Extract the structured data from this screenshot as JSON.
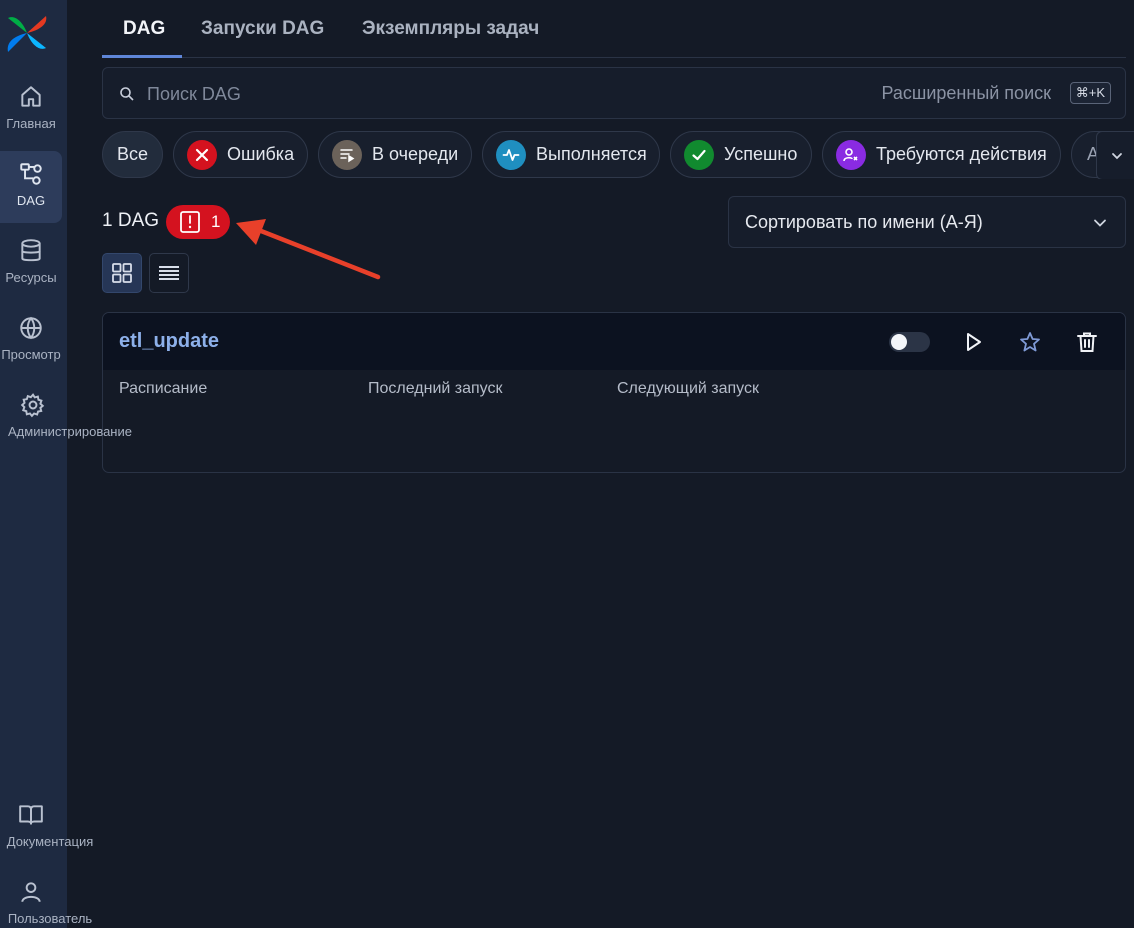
{
  "sidebar": {
    "items": [
      {
        "label": "Главная",
        "icon": "home-icon"
      },
      {
        "label": "DAG",
        "icon": "dag-icon",
        "active": true
      },
      {
        "label": "Ресурсы",
        "icon": "database-icon"
      },
      {
        "label": "Просмотр",
        "icon": "globe-icon"
      },
      {
        "label": "Администрирование",
        "icon": "gear-icon"
      }
    ],
    "bottom_items": [
      {
        "label": "Документация",
        "icon": "book-icon"
      },
      {
        "label": "Пользователь",
        "icon": "user-icon"
      }
    ]
  },
  "tabs": [
    {
      "label": "DAG",
      "active": true
    },
    {
      "label": "Запуски DAG"
    },
    {
      "label": "Экземпляры задач"
    }
  ],
  "search": {
    "placeholder": "Поиск DAG",
    "advanced_label": "Расширенный поиск",
    "shortcut": "⌘+K"
  },
  "filters": [
    {
      "label": "Все",
      "active": true
    },
    {
      "label": "Ошибка",
      "icon": "x-icon",
      "color": "#d4121f"
    },
    {
      "label": "В очереди",
      "icon": "queue-icon",
      "color": "#6b625a"
    },
    {
      "label": "Выполняется",
      "icon": "activity-icon",
      "color": "#1f8fc0"
    },
    {
      "label": "Успешно",
      "icon": "check-icon",
      "color": "#118a2f"
    },
    {
      "label": "Требуются действия",
      "icon": "user-action-icon",
      "color": "#8a2be2"
    },
    {
      "label": "А"
    }
  ],
  "summary": {
    "count_label": "1 DAG",
    "error_count": "1"
  },
  "sort": {
    "selected": "Сортировать по имени (А-Я)"
  },
  "view": {
    "mode": "grid"
  },
  "dags": [
    {
      "name": "etl_update",
      "enabled": false,
      "columns": [
        "Расписание",
        "Последний запуск",
        "Следующий запуск"
      ]
    }
  ],
  "colors": {
    "sidebar_bg": "#1e2a41",
    "page_bg": "#141a26",
    "accent": "#5f86d8",
    "error": "#d4121f",
    "annotation_arrow": "#e8402a"
  }
}
